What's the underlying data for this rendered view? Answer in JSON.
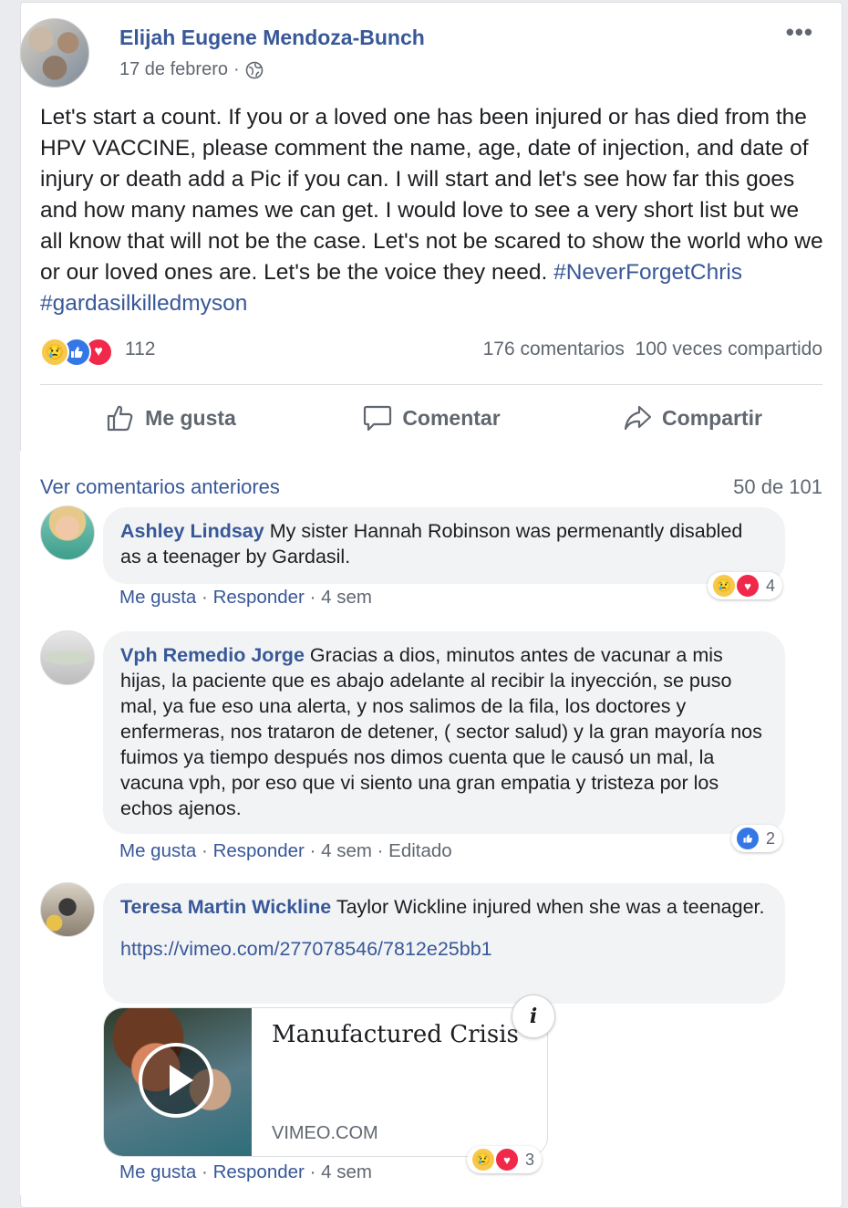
{
  "post": {
    "author": "Elijah Eugene Mendoza-Bunch",
    "date": "17 de febrero",
    "separator": "·",
    "more_label": "•••",
    "text": "Let's start a count. If you or a loved one has been injured or has died from the HPV VACCINE, please comment the name, age, date of injection, and date of injury or death add a Pic if you can. I will start and let's see how far this goes and how many names we can get. I would love to see a very short list but we all know that will not be the case. Let's not be scared to show the world who we or our loved ones are. Let's be the voice they need. ",
    "hashtags": [
      "#NeverForgetChris",
      "#gardasilkilledmyson"
    ],
    "reaction_count": "112",
    "comments_count": "176 comentarios",
    "shares_count": "100 veces compartido",
    "reaction_icons": [
      "sad-reaction",
      "like-reaction",
      "love-reaction"
    ]
  },
  "actions": {
    "like": "Me gusta",
    "comment": "Comentar",
    "share": "Compartir"
  },
  "comments_header": {
    "view_previous": "Ver comentarios anteriores",
    "page_count": "50 de 101"
  },
  "comment_meta": {
    "like": "Me gusta",
    "reply": "Responder",
    "dot": "·"
  },
  "comments": [
    {
      "name": "Ashley Lindsay",
      "text": "My sister Hannah Robinson was permenantly disabled as a teenager by Gardasil.",
      "time": "4 sem",
      "reactions": "4"
    },
    {
      "name": "Vph Remedio Jorge",
      "text": "Gracias a dios, minutos antes de vacunar a mis hijas, la paciente que es abajo adelante al recibir la inyección, se puso mal, ya fue eso una alerta, y nos salimos de la fila, los doctores y enfermeras, nos trataron de detener, ( sector salud) y la gran mayoría nos fuimos ya tiempo después nos dimos cuenta que le causó un mal, la vacuna vph, por eso que vi siento una gran empatia y tristeza por los echos ajenos.",
      "time": "4 sem",
      "edited": "Editado",
      "reactions": "2"
    },
    {
      "name": "Teresa Martin Wickline",
      "text": "Taylor Wickline injured when she was a teenager.",
      "link": "https://vimeo.com/277078546/7812e25bb1",
      "time": "4 sem",
      "reactions": "3",
      "preview": {
        "title": "Manufactured Crisis",
        "domain": "VIMEO.COM",
        "info": "i"
      }
    }
  ],
  "colors": {
    "link": "#385898",
    "muted": "#606770",
    "bubble": "#f2f3f5",
    "like": "#3578e5",
    "love": "#f0284a",
    "sad": "#f7c94a"
  }
}
